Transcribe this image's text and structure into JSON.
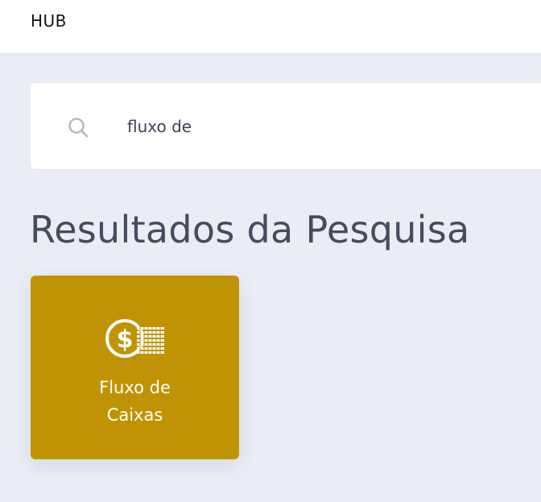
{
  "header": {
    "brand": "HUB"
  },
  "search": {
    "icon": "search-icon",
    "value": "fluxo de",
    "placeholder": ""
  },
  "results": {
    "title": "Resultados da Pesquisa",
    "items": [
      {
        "icon": "money-coins-icon",
        "label": "Fluxo de\nCaixas",
        "color": "#c09304"
      }
    ]
  },
  "colors": {
    "background": "#eaedf5",
    "card_accent": "#c09304",
    "title_text": "#454c60"
  }
}
